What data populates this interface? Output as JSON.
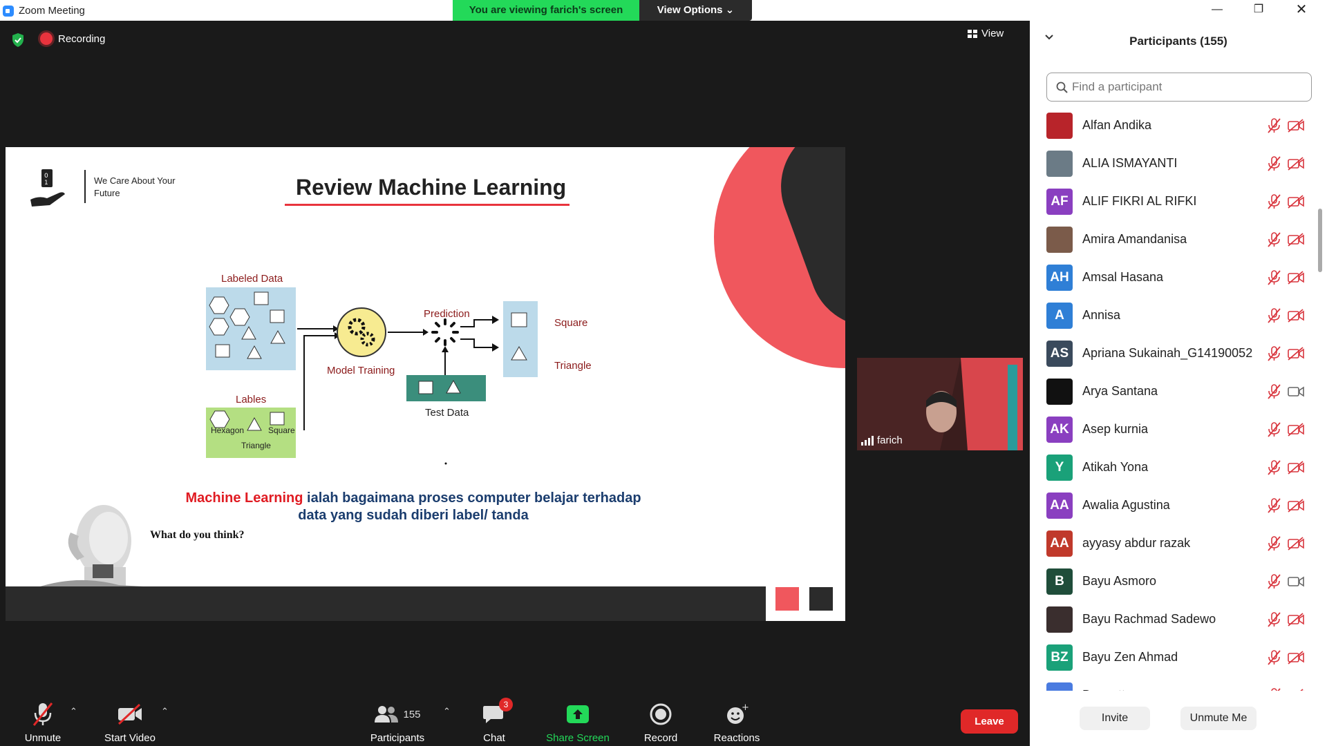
{
  "window": {
    "title": "Zoom Meeting"
  },
  "banner": {
    "viewing": "You are viewing farich's screen",
    "options": "View Options"
  },
  "status": {
    "recording": "Recording",
    "view": "View"
  },
  "slide": {
    "tagline": "We Care About Your Future",
    "title": "Review Machine Learning",
    "labeled_data": "Labeled Data",
    "lables": "Lables",
    "hexagon": "Hexagon",
    "square_small": "Square",
    "triangle_small": "Triangle",
    "model_training": "Model Training",
    "prediction": "Prediction",
    "test_data": "Test Data",
    "out_square": "Square",
    "out_triangle": "Triangle",
    "caption_highlight": "Machine Learning",
    "caption_rest": " ialah bagaimana proses computer belajar terhadap data yang sudah diberi label/ tanda",
    "question": "What do you think?",
    "colors": {
      "accent_red": "#f0575d",
      "dark": "#2b2b2b",
      "box_blue": "#bcdaea",
      "box_green": "#b4df82",
      "box_teal": "#3b8e7c"
    }
  },
  "presenter": {
    "name": "farich"
  },
  "toolbar": {
    "unmute": "Unmute",
    "start_video": "Start Video",
    "participants": "Participants",
    "participants_count": "155",
    "chat": "Chat",
    "chat_badge": "3",
    "share_screen": "Share Screen",
    "record": "Record",
    "reactions": "Reactions",
    "leave": "Leave"
  },
  "panel": {
    "title": "Participants (155)",
    "search_placeholder": "Find a participant",
    "participants": [
      {
        "name": "Alfan Andika",
        "initials": "",
        "color": "#b8242a",
        "video": "off"
      },
      {
        "name": "ALIA ISMAYANTI",
        "initials": "",
        "color": "#6b7b86",
        "video": "off"
      },
      {
        "name": "ALIF FIKRI AL RIFKI",
        "initials": "AF",
        "color": "#8a3fc0",
        "video": "off"
      },
      {
        "name": "Amira Amandanisa",
        "initials": "",
        "color": "#7b5b4a",
        "video": "off"
      },
      {
        "name": "Amsal Hasana",
        "initials": "AH",
        "color": "#2f7fd6",
        "video": "off"
      },
      {
        "name": "Annisa",
        "initials": "A",
        "color": "#2f7fd6",
        "video": "off"
      },
      {
        "name": "Apriana Sukainah_G14190052",
        "initials": "AS",
        "color": "#3a4a5c",
        "video": "off"
      },
      {
        "name": "Arya Santana",
        "initials": "",
        "color": "#111111",
        "video": "on"
      },
      {
        "name": "Asep kurnia",
        "initials": "AK",
        "color": "#8a3fc0",
        "video": "off"
      },
      {
        "name": "Atikah Yona",
        "initials": "Y",
        "color": "#1aa179",
        "video": "off"
      },
      {
        "name": "Awalia Agustina",
        "initials": "AA",
        "color": "#8a3fc0",
        "video": "off"
      },
      {
        "name": "ayyasy abdur razak",
        "initials": "AA",
        "color": "#c0392b",
        "video": "off"
      },
      {
        "name": "Bayu Asmoro",
        "initials": "B",
        "color": "#1f4d3a",
        "video": "on"
      },
      {
        "name": "Bayu Rachmad Sadewo",
        "initials": "",
        "color": "#3a2e2e",
        "video": "off"
      },
      {
        "name": "Bayu Zen Ahmad",
        "initials": "BZ",
        "color": "#1aa179",
        "video": "off"
      },
      {
        "name": "Bennett",
        "initials": "",
        "color": "#4a7be0",
        "video": "off"
      }
    ],
    "invite": "Invite",
    "unmute_me": "Unmute Me"
  }
}
